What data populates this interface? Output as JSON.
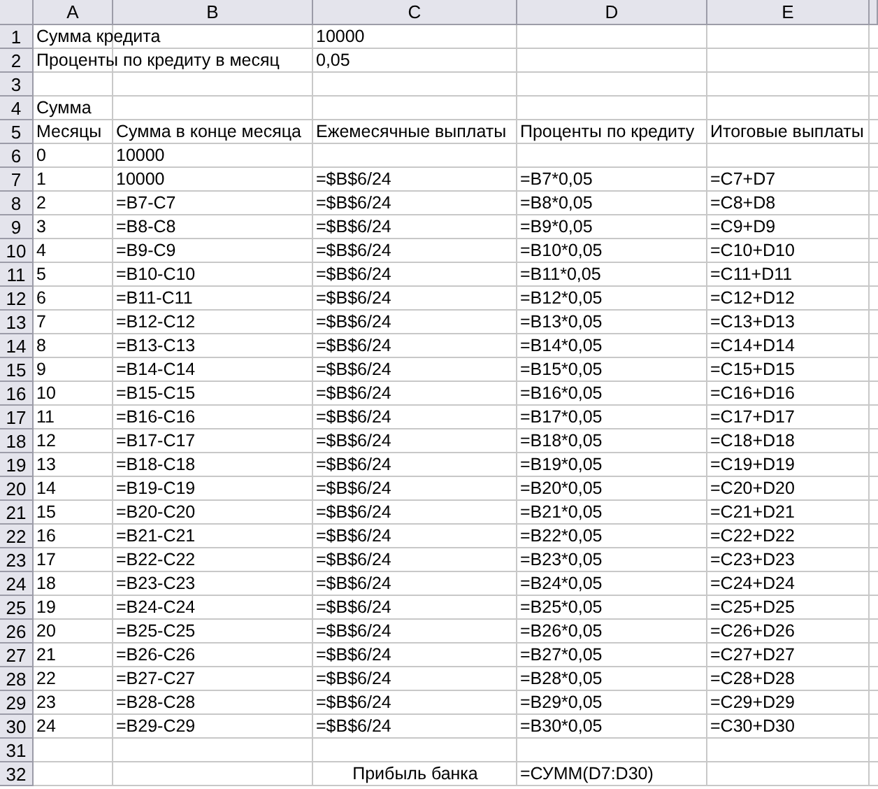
{
  "columns": [
    "A",
    "B",
    "C",
    "D",
    "E"
  ],
  "rows": [
    {
      "number": "1",
      "cells": {
        "A": "Сумма кредита",
        "C": "10000"
      }
    },
    {
      "number": "2",
      "cells": {
        "A": "Проценты по кредиту в месяц",
        "C": "0,05"
      }
    },
    {
      "number": "3",
      "cells": {}
    },
    {
      "number": "4",
      "cells": {
        "A": "Сумма"
      }
    },
    {
      "number": "5",
      "cells": {
        "A": "Месяцы",
        "B": "Сумма в конце месяца",
        "C": "Ежемесячные выплаты",
        "D": "Проценты по кредиту",
        "E": "Итоговые выплаты"
      }
    },
    {
      "number": "6",
      "cells": {
        "A": "0",
        "B": "10000"
      }
    },
    {
      "number": "7",
      "cells": {
        "A": "1",
        "B": "10000",
        "C": "=$B$6/24",
        "D": "=B7*0,05",
        "E": "=C7+D7"
      }
    },
    {
      "number": "8",
      "cells": {
        "A": "2",
        "B": "=B7-C7",
        "C": "=$B$6/24",
        "D": "=B8*0,05",
        "E": "=C8+D8"
      }
    },
    {
      "number": "9",
      "cells": {
        "A": "3",
        "B": "=B8-C8",
        "C": "=$B$6/24",
        "D": "=B9*0,05",
        "E": "=C9+D9"
      }
    },
    {
      "number": "10",
      "cells": {
        "A": "4",
        "B": "=B9-C9",
        "C": "=$B$6/24",
        "D": "=B10*0,05",
        "E": "=C10+D10"
      }
    },
    {
      "number": "11",
      "cells": {
        "A": "5",
        "B": "=B10-C10",
        "C": "=$B$6/24",
        "D": "=B11*0,05",
        "E": "=C11+D11"
      }
    },
    {
      "number": "12",
      "cells": {
        "A": "6",
        "B": "=B11-C11",
        "C": "=$B$6/24",
        "D": "=B12*0,05",
        "E": "=C12+D12"
      }
    },
    {
      "number": "13",
      "cells": {
        "A": "7",
        "B": "=B12-C12",
        "C": "=$B$6/24",
        "D": "=B13*0,05",
        "E": "=C13+D13"
      }
    },
    {
      "number": "14",
      "cells": {
        "A": "8",
        "B": "=B13-C13",
        "C": "=$B$6/24",
        "D": "=B14*0,05",
        "E": "=C14+D14"
      }
    },
    {
      "number": "15",
      "cells": {
        "A": "9",
        "B": "=B14-C14",
        "C": "=$B$6/24",
        "D": "=B15*0,05",
        "E": "=C15+D15"
      }
    },
    {
      "number": "16",
      "cells": {
        "A": "10",
        "B": "=B15-C15",
        "C": "=$B$6/24",
        "D": "=B16*0,05",
        "E": "=C16+D16"
      }
    },
    {
      "number": "17",
      "cells": {
        "A": "11",
        "B": "=B16-C16",
        "C": "=$B$6/24",
        "D": "=B17*0,05",
        "E": "=C17+D17"
      }
    },
    {
      "number": "18",
      "cells": {
        "A": "12",
        "B": "=B17-C17",
        "C": "=$B$6/24",
        "D": "=B18*0,05",
        "E": "=C18+D18"
      }
    },
    {
      "number": "19",
      "cells": {
        "A": "13",
        "B": "=B18-C18",
        "C": "=$B$6/24",
        "D": "=B19*0,05",
        "E": "=C19+D19"
      }
    },
    {
      "number": "20",
      "cells": {
        "A": "14",
        "B": "=B19-C19",
        "C": "=$B$6/24",
        "D": "=B20*0,05",
        "E": "=C20+D20"
      }
    },
    {
      "number": "21",
      "cells": {
        "A": "15",
        "B": "=B20-C20",
        "C": "=$B$6/24",
        "D": "=B21*0,05",
        "E": "=C21+D21"
      }
    },
    {
      "number": "22",
      "cells": {
        "A": "16",
        "B": "=B21-C21",
        "C": "=$B$6/24",
        "D": "=B22*0,05",
        "E": "=C22+D22"
      }
    },
    {
      "number": "23",
      "cells": {
        "A": "17",
        "B": "=B22-C22",
        "C": "=$B$6/24",
        "D": "=B23*0,05",
        "E": "=C23+D23"
      }
    },
    {
      "number": "24",
      "cells": {
        "A": "18",
        "B": "=B23-C23",
        "C": "=$B$6/24",
        "D": "=B24*0,05",
        "E": "=C24+D24"
      }
    },
    {
      "number": "25",
      "cells": {
        "A": "19",
        "B": "=B24-C24",
        "C": "=$B$6/24",
        "D": "=B25*0,05",
        "E": "=C25+D25"
      }
    },
    {
      "number": "26",
      "cells": {
        "A": "20",
        "B": "=B25-C25",
        "C": "=$B$6/24",
        "D": "=B26*0,05",
        "E": "=C26+D26"
      }
    },
    {
      "number": "27",
      "cells": {
        "A": "21",
        "B": "=B26-C26",
        "C": "=$B$6/24",
        "D": "=B27*0,05",
        "E": "=C27+D27"
      }
    },
    {
      "number": "28",
      "cells": {
        "A": "22",
        "B": "=B27-C27",
        "C": "=$B$6/24",
        "D": "=B28*0,05",
        "E": "=C28+D28"
      }
    },
    {
      "number": "29",
      "cells": {
        "A": "23",
        "B": "=B28-C28",
        "C": "=$B$6/24",
        "D": "=B29*0,05",
        "E": "=C29+D29"
      }
    },
    {
      "number": "30",
      "cells": {
        "A": "24",
        "B": "=B29-C29",
        "C": "=$B$6/24",
        "D": "=B30*0,05",
        "E": "=C30+D30"
      }
    },
    {
      "number": "31",
      "cells": {}
    },
    {
      "number": "32",
      "cells": {
        "C": "Прибыль банка",
        "D": "=СУММ(D7:D30)"
      },
      "centered": {
        "C": true
      }
    }
  ]
}
